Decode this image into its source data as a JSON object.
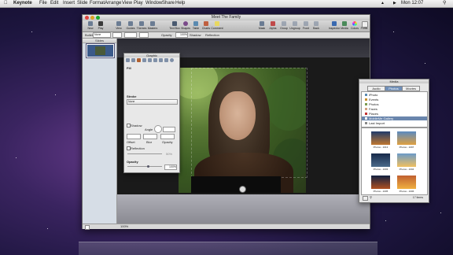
{
  "menubar": {
    "app_name": "Keynote",
    "items": [
      "File",
      "Edit",
      "Insert",
      "Slide",
      "Format",
      "Arrange",
      "View",
      "Play",
      "Window",
      "Share",
      "Help"
    ],
    "clock": "Mon 12:07",
    "search_icon": "search-icon"
  },
  "window": {
    "title": "Meet The Family",
    "toolbar": {
      "left": [
        "New",
        "Play",
        "View",
        "Guides",
        "Themes",
        "Masters"
      ],
      "middle": [
        "Text Box",
        "Shapes",
        "Table",
        "Charts",
        "Comment"
      ],
      "right": [
        "Mask",
        "Alpha",
        "Group",
        "Ungroup",
        "Front",
        "Back",
        "Inspector",
        "Media",
        "Colors",
        "Fonts"
      ]
    },
    "format_bar": {
      "labels": [
        "Bullet",
        "None",
        "Opacity",
        "Shadow",
        "Reflection"
      ],
      "opacity_value": "100%"
    },
    "slide_nav_header": "Slides",
    "status_zoom": "100%"
  },
  "inspector": {
    "title": "Graphic",
    "fill_label": "Fill",
    "stroke_label": "Stroke",
    "stroke_value": "None",
    "shadow_label": "Shadow",
    "angle_label": "Angle",
    "offset_label": "Offset",
    "blur_label": "Blur",
    "opacity_label": "Opacity",
    "reflection_label": "Reflection",
    "reflection_value": "50%",
    "opacity_section_label": "Opacity",
    "opacity_value": "100%"
  },
  "media": {
    "title": "Media",
    "tabs": [
      "Audio",
      "Photos",
      "Movies"
    ],
    "active_tab": "Photos",
    "library": [
      {
        "label": "iPhoto",
        "selected": false
      },
      {
        "label": "Events",
        "selected": false
      },
      {
        "label": "Photos",
        "selected": false
      },
      {
        "label": "Faces",
        "selected": false
      },
      {
        "label": "Places",
        "selected": false
      },
      {
        "label": "MobileMe Gallery",
        "selected": true
      },
      {
        "label": "Last Import",
        "selected": false
      }
    ],
    "photos": [
      {
        "caption": "Photos - 1013"
      },
      {
        "caption": "Photos - 1097"
      },
      {
        "caption": "Photos - 1003"
      },
      {
        "caption": "Photos - 1004"
      },
      {
        "caption": "Photos - 1005"
      },
      {
        "caption": "Photos - 1006"
      }
    ],
    "item_count": "17 items"
  },
  "colors": {
    "menubar_bg": "#e6e6e6",
    "selection_blue": "#6a86ad",
    "desktop_purple": "#3a2460"
  }
}
